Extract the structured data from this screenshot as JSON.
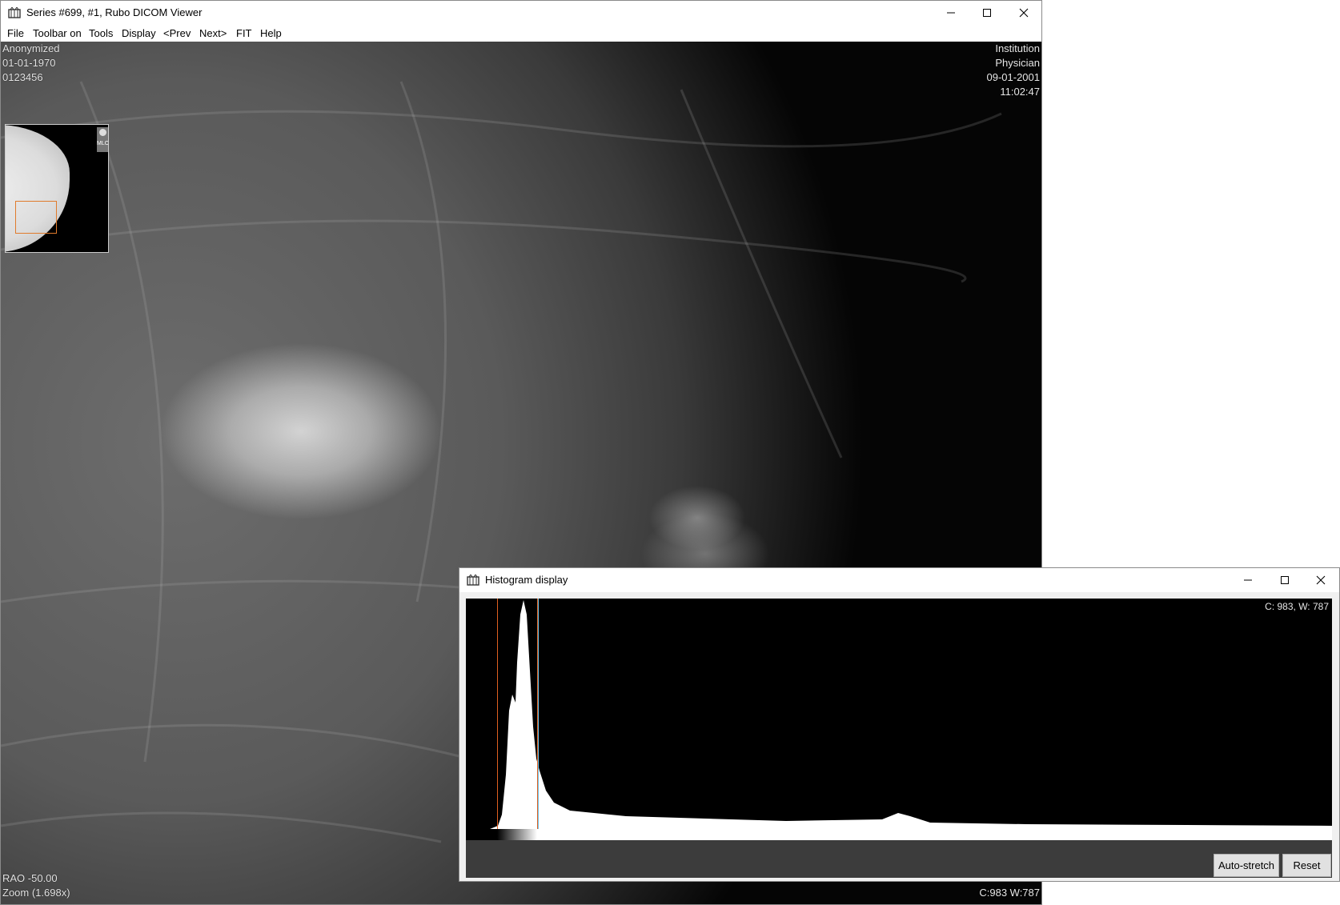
{
  "viewer": {
    "title": "Series #699, #1, Rubo DICOM Viewer",
    "menu": [
      "File",
      "Toolbar on",
      "Tools",
      "Display",
      "<Prev",
      "Next>",
      "FIT",
      "Help"
    ],
    "overlay_tl": [
      "Anonymized",
      "01-01-1970",
      "0123456"
    ],
    "overlay_tr": [
      "Institution",
      "Physician",
      "09-01-2001",
      "11:02:47"
    ],
    "overlay_bl": [
      "RAO -50.00",
      "Zoom (1.698x)"
    ],
    "overlay_br": "C:983 W:787",
    "thumbnail_marker": "MLO"
  },
  "histogram": {
    "title": "Histogram display",
    "cw_label": "C: 983, W: 787",
    "buttons": {
      "auto_stretch": "Auto-stretch",
      "reset": "Reset"
    },
    "window_line_color": "#e06020",
    "level_line_color": "#6ec3e8"
  }
}
